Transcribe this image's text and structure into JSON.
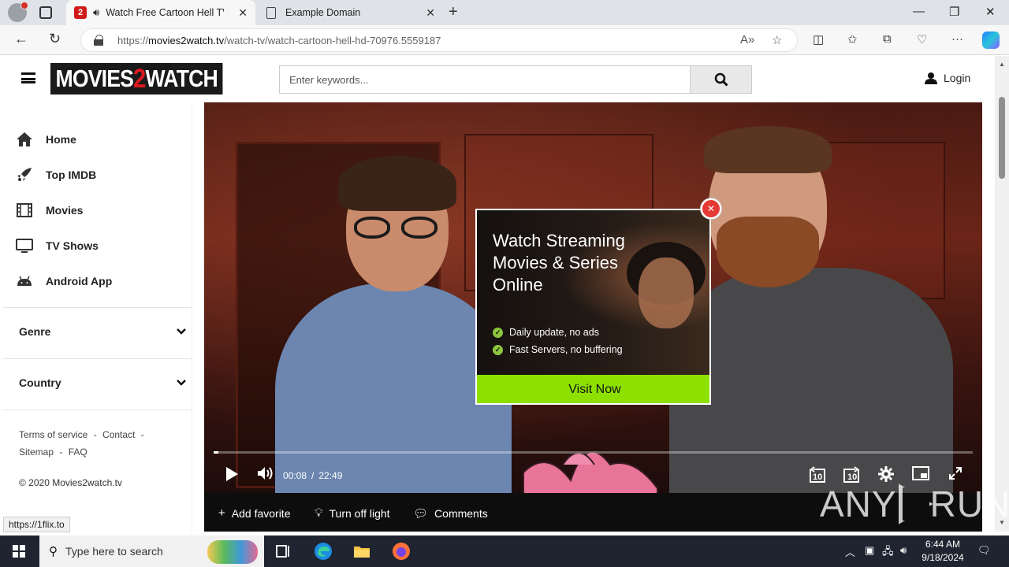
{
  "browser": {
    "tabs": [
      {
        "title": "Watch Free Cartoon Hell TV",
        "favicon": "movies2watch-favicon",
        "audio": true,
        "active": true
      },
      {
        "title": "Example Domain",
        "favicon": "document-icon",
        "active": false
      }
    ],
    "url_prefix": "https://",
    "url_domain": "movies2watch.tv",
    "url_path": "/watch-tv/watch-cartoon-hell-hd-70976.5559187",
    "status_tip": "https://1flix.to"
  },
  "site": {
    "logo_part1": "MOVIES",
    "logo_part2": "2",
    "logo_part3": "WATCH",
    "search_placeholder": "Enter keywords...",
    "login_label": "Login"
  },
  "sidebar": {
    "items": [
      {
        "label": "Home",
        "icon": "home-icon"
      },
      {
        "label": "Top IMDB",
        "icon": "rocket-icon"
      },
      {
        "label": "Movies",
        "icon": "film-icon"
      },
      {
        "label": "TV Shows",
        "icon": "tv-icon"
      },
      {
        "label": "Android App",
        "icon": "android-icon"
      }
    ],
    "genre_label": "Genre",
    "country_label": "Country",
    "footer_links": {
      "terms": "Terms of service",
      "contact": "Contact",
      "sitemap": "Sitemap",
      "faq": "FAQ",
      "separator": "-"
    },
    "copyright": "© 2020 Movies2watch.tv"
  },
  "player": {
    "current_time": "00:08",
    "separator": "/",
    "duration": "22:49",
    "progress_fraction": 0.006,
    "rewind_label": "10",
    "forward_label": "10"
  },
  "actions": {
    "add_favorite": "Add favorite",
    "turn_off_light": "Turn off light",
    "comments": "Comments"
  },
  "ad": {
    "title": "Watch Streaming Movies & Series Online",
    "features": [
      "Daily update, no ads",
      "Fast Servers, no buffering"
    ],
    "cta": "Visit Now",
    "accent": "#8ee000"
  },
  "watermark": {
    "left": "ANY",
    "right": "RUN"
  },
  "taskbar": {
    "search_placeholder": "Type here to search",
    "time": "6:44 AM",
    "date": "9/18/2024"
  }
}
